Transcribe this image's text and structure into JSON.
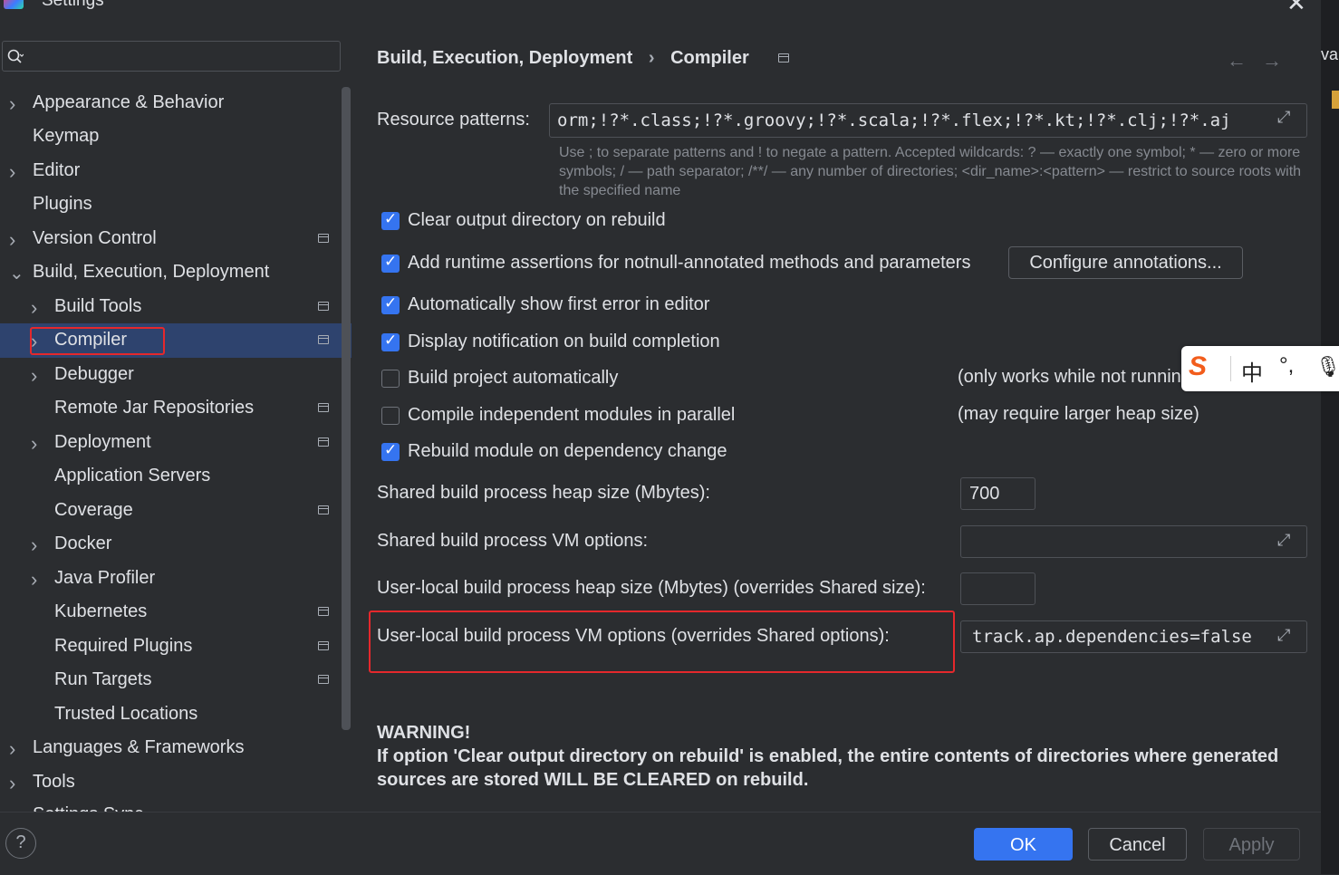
{
  "window": {
    "title": "Settings"
  },
  "search": {
    "placeholder": "",
    "value": ""
  },
  "sidebar": {
    "items": [
      {
        "label": "Appearance & Behavior",
        "level": 0,
        "expandable": true
      },
      {
        "label": "Keymap",
        "level": 0,
        "expandable": false
      },
      {
        "label": "Editor",
        "level": 0,
        "expandable": true
      },
      {
        "label": "Plugins",
        "level": 0,
        "expandable": false
      },
      {
        "label": "Version Control",
        "level": 0,
        "expandable": true,
        "project_icon": true
      },
      {
        "label": "Build, Execution, Deployment",
        "level": 0,
        "expanded": true
      },
      {
        "label": "Build Tools",
        "level": 1,
        "expandable": true,
        "project_icon": true
      },
      {
        "label": "Compiler",
        "level": 1,
        "expandable": true,
        "project_icon": true,
        "selected": true
      },
      {
        "label": "Debugger",
        "level": 1,
        "expandable": true
      },
      {
        "label": "Remote Jar Repositories",
        "level": 1,
        "project_icon": true
      },
      {
        "label": "Deployment",
        "level": 1,
        "expandable": true,
        "project_icon": true
      },
      {
        "label": "Application Servers",
        "level": 1
      },
      {
        "label": "Coverage",
        "level": 1,
        "project_icon": true
      },
      {
        "label": "Docker",
        "level": 1,
        "expandable": true
      },
      {
        "label": "Java Profiler",
        "level": 1,
        "expandable": true
      },
      {
        "label": "Kubernetes",
        "level": 1,
        "project_icon": true
      },
      {
        "label": "Required Plugins",
        "level": 1,
        "project_icon": true
      },
      {
        "label": "Run Targets",
        "level": 1,
        "project_icon": true
      },
      {
        "label": "Trusted Locations",
        "level": 1
      },
      {
        "label": "Languages & Frameworks",
        "level": 0,
        "expandable": true
      },
      {
        "label": "Tools",
        "level": 0,
        "expandable": true
      },
      {
        "label": "Settings Sync",
        "level": 0,
        "expandable": true,
        "partially_visible": true
      }
    ]
  },
  "breadcrumb": {
    "parent": "Build, Execution, Deployment",
    "separator": "›",
    "current": "Compiler"
  },
  "nav": {
    "back": "←",
    "forward": "→"
  },
  "compiler": {
    "resource_patterns_label": "Resource patterns:",
    "resource_patterns_value": "orm;!?*.class;!?*.groovy;!?*.scala;!?*.flex;!?*.kt;!?*.clj;!?*.aj",
    "resource_hint": "Use ; to separate patterns and ! to negate a pattern. Accepted wildcards: ? — exactly one symbol; * — zero or more symbols; / — path separator; /**/ — any number of directories; <dir_name>:<pattern> — restrict to source roots with the specified name",
    "checkboxes": [
      {
        "label": "Clear output directory on rebuild",
        "checked": true
      },
      {
        "label": "Add runtime assertions for notnull-annotated methods and parameters",
        "checked": true
      },
      {
        "label": "Automatically show first error in editor",
        "checked": true
      },
      {
        "label": "Display notification on build completion",
        "checked": true
      },
      {
        "label": "Build project automatically",
        "checked": false,
        "note": "(only works while not running / debugging)"
      },
      {
        "label": "Compile independent modules in parallel",
        "checked": false,
        "note": "(may require larger heap size)"
      },
      {
        "label": "Rebuild module on dependency change",
        "checked": true
      }
    ],
    "configure_annotations_label": "Configure annotations...",
    "shared_heap_label": "Shared build process heap size (Mbytes):",
    "shared_heap_value": "700",
    "shared_vm_label": "Shared build process VM options:",
    "shared_vm_value": "",
    "user_heap_label": "User-local build process heap size (Mbytes) (overrides Shared size):",
    "user_heap_value": "",
    "user_vm_label": "User-local build process VM options (overrides Shared options):",
    "user_vm_value": "track.ap.dependencies=false",
    "warning_title": "WARNING!",
    "warning_text": "If option 'Clear output directory on rebuild' is enabled, the entire contents of directories where generated sources are stored WILL BE CLEARED on rebuild."
  },
  "buttons": {
    "ok": "OK",
    "cancel": "Cancel",
    "apply": "Apply",
    "help": "?"
  },
  "ime": {
    "logo": "S",
    "lang": "中",
    "punct": "°,",
    "mic": "🎙"
  },
  "background_editor_text": "va",
  "colors": {
    "accent": "#3574f0",
    "selection": "#2e436e",
    "highlight_box": "#e5282c",
    "background": "#2b2d30"
  }
}
